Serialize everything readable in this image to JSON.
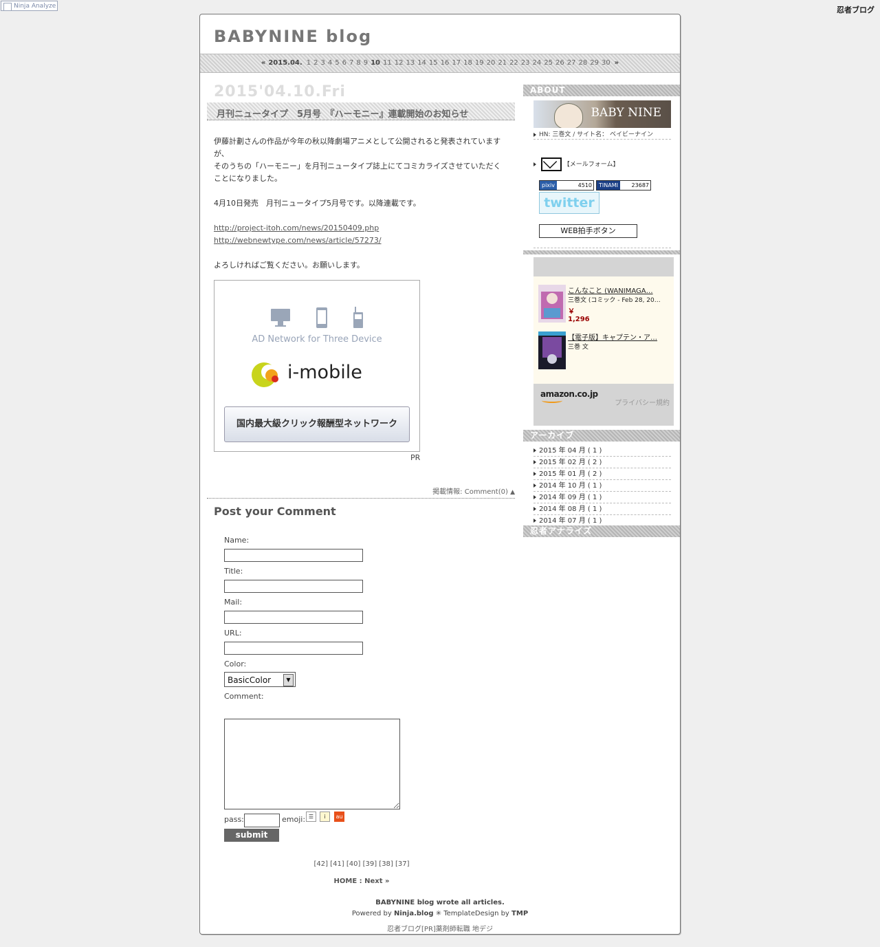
{
  "top": {
    "ninja_analyze": "Ninja Analyze",
    "ninja_blog_logo": "忍者ブログ"
  },
  "site": {
    "title": "BABYNINE blog"
  },
  "calendar": {
    "prev": "«",
    "month": "2015.04.",
    "days": [
      "1",
      "2",
      "3",
      "4",
      "5",
      "6",
      "7",
      "8",
      "9",
      "10",
      "11",
      "12",
      "13",
      "14",
      "15",
      "16",
      "17",
      "18",
      "19",
      "20",
      "21",
      "22",
      "23",
      "24",
      "25",
      "26",
      "27",
      "28",
      "29",
      "30"
    ],
    "active_day": "10",
    "next": "»"
  },
  "entry": {
    "date": "2015'04.10.Fri",
    "title": "月刊ニュータイプ　5月号　『ハーモニー』連載開始のお知らせ",
    "p1_line1": "伊藤計劃さんの作品が今年の秋以降劇場アニメとして公開されると発表されていますが、",
    "p1_line2": "そのうちの「ハーモニー」を月刊ニュータイプ誌上にてコミカライズさせていただくことになりました。",
    "p2": "4月10日発売　月刊ニュータイプ5月号です。以降連載です。",
    "link1": "http://project-itoh.com/news/20150409.php",
    "link2": "http://webnewtype.com/news/article/57273/",
    "p4": "よろしければご覧ください。お願いします。",
    "meta_label": "掲載情報:",
    "meta_comment": "Comment(0)",
    "meta_arrow": "▲"
  },
  "ad": {
    "network_text": "AD Network for Three Device",
    "brand": "i-mobile",
    "cta": "国内最大級クリック報酬型ネットワーク",
    "pr": "PR"
  },
  "comment_form": {
    "heading": "Post your Comment",
    "name_label": "Name:",
    "title_label": "Title:",
    "mail_label": "Mail:",
    "url_label": "URL:",
    "color_label": "Color:",
    "color_value": "BasicColor",
    "comment_label": "Comment:",
    "pass_label": "pass:",
    "emoji_label": "emoji:",
    "emoji_au": "au",
    "submit": "submit"
  },
  "pager": {
    "pages": "[42] [41] [40] [39] [38] [37]",
    "home_next": "HOME : Next »"
  },
  "footer": {
    "line1": "BABYNINE blog wrote all articles.",
    "powered_prefix": "Powered by",
    "ninja": "Ninja.blog",
    "sep": "✳ TemplateDesign by",
    "tmp": "TMP",
    "below": "忍者ブログ[PR]薬剤師転職 地デジ"
  },
  "sidebar": {
    "about_heading": "ABOUT",
    "banner_name": "BABY NINE",
    "hn_line": "HN: 三巻文 / サイト名： ベイビーナイン",
    "mailform": "【メールフォーム】",
    "pixiv_label": "pixiv",
    "pixiv_count": "4510",
    "tinami_label": "TINAMI",
    "tinami_count": "23687",
    "twitter": "twitter",
    "clap_button": "WEB拍手ボタン",
    "amazon": {
      "items": [
        {
          "title": "こんなこと (WANIMAGA…",
          "sub": "三巻文 (コミック - Feb 28, 20…",
          "price": "￥ 1,296"
        },
        {
          "title": "【電子版】キャプテン・ア…",
          "sub": "三巻 文",
          "price": ""
        }
      ],
      "logo": "amazon.co.jp",
      "privacy": "プライバシー規約"
    },
    "archive_heading": "アーカイブ",
    "archives": [
      "2015 年 04 月 ( 1 )",
      "2015 年 02 月 ( 2 )",
      "2015 年 01 月 ( 2 )",
      "2014 年 10 月 ( 1 )",
      "2014 年 09 月 ( 1 )",
      "2014 年 08 月 ( 1 )",
      "2014 年 07 月 ( 1 )"
    ],
    "analyze_heading": "忍者アナライズ"
  }
}
